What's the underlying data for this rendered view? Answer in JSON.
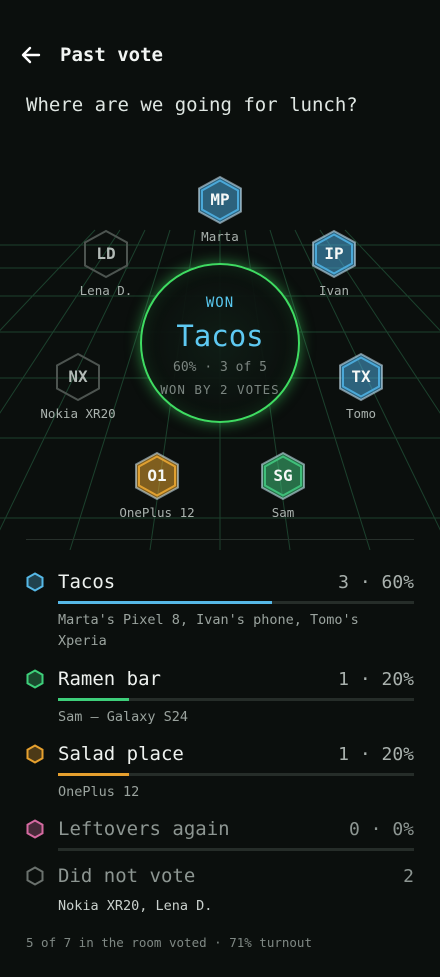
{
  "header": {
    "title": "Past vote",
    "back_icon": "arrow-left-icon"
  },
  "question": "Where are we going for lunch?",
  "result": {
    "label": "WON",
    "winner": "Tacos",
    "stats": "60%  ·  3 of 5",
    "margin": "WON BY 2 VOTES"
  },
  "voters": [
    {
      "initials": "MP",
      "name": "Marta",
      "color": "#4aa8d8",
      "voted": true
    },
    {
      "initials": "IP",
      "name": "Ivan",
      "color": "#4aa8d8",
      "voted": true
    },
    {
      "initials": "TX",
      "name": "Tomo",
      "color": "#4aa8d8",
      "voted": true
    },
    {
      "initials": "SG",
      "name": "Sam",
      "color": "#3fbf7a",
      "voted": true
    },
    {
      "initials": "O1",
      "name": "OnePlus 12",
      "color": "#e0a030",
      "voted": true
    },
    {
      "initials": "NX",
      "name": "Nokia XR20",
      "color": "#5a605d",
      "voted": false
    },
    {
      "initials": "LD",
      "name": "Lena D.",
      "color": "#5a605d",
      "voted": false
    }
  ],
  "options": [
    {
      "name": "Tacos",
      "count": "3 · 60%",
      "share": 0.6,
      "color": "#56b8e6",
      "voters": "Marta's Pixel 8, Ivan's phone, Tomo's Xperia"
    },
    {
      "name": "Ramen bar",
      "count": "1 · 20%",
      "share": 0.2,
      "color": "#3ecf7a",
      "voters": "Sam — Galaxy S24"
    },
    {
      "name": "Salad place",
      "count": "1 · 20%",
      "share": 0.2,
      "color": "#e6a02e",
      "voters": "OnePlus 12"
    },
    {
      "name": "Leftovers again",
      "count": "0 · 0%",
      "share": 0,
      "color": "#d46aa0",
      "voters": ""
    }
  ],
  "non_voters": {
    "label": "Did not vote",
    "count": "2",
    "names": "Nokia XR20, Lena D.",
    "color": "#6a716d"
  },
  "footer": "5 of 7 in the room voted · 71% turnout"
}
